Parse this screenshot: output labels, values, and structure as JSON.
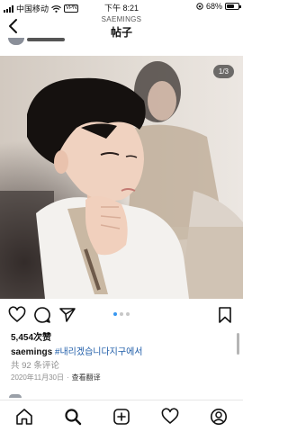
{
  "status_bar": {
    "carrier": "中国移动",
    "vpn": "VPN",
    "time": "下午 8:21",
    "battery": "68%",
    "battery_level": 0.68
  },
  "header": {
    "account": "SAEMINGS",
    "title": "帖子"
  },
  "post": {
    "page_indicator": "1/3",
    "carousel_active_index": 0,
    "carousel_count": 3,
    "likes": "5,454次赞",
    "username": "saemings",
    "hashtag": "#내리겠습니다지구에서",
    "comments_link": "共 92 条评论",
    "date": "2020年11月30日",
    "separator": "·",
    "translate": "查看翻译"
  },
  "icons": {
    "back": "chevron-left-icon",
    "like": "heart-icon",
    "comment": "comment-icon",
    "share": "paper-plane-icon",
    "save": "bookmark-icon",
    "tabs": [
      "home-icon",
      "search-icon",
      "new-post-icon",
      "activity-heart-icon",
      "profile-icon"
    ]
  }
}
